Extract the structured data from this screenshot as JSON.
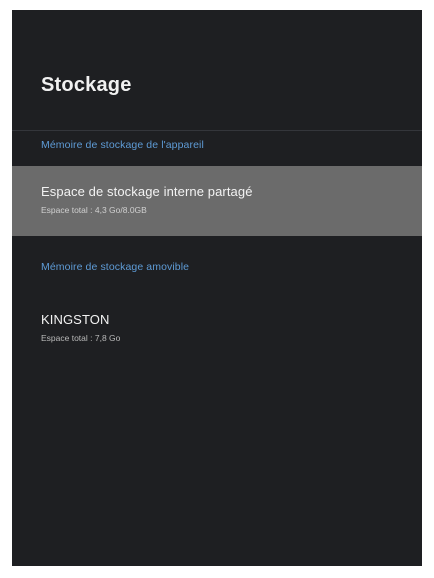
{
  "screen": {
    "title": "Stockage"
  },
  "sections": [
    {
      "header": "Mémoire de stockage de l'appareil",
      "items": [
        {
          "title": "Espace de stockage interne partagé",
          "subtitle": "Espace total : 4,3 Go/8.0GB",
          "selected": true
        }
      ]
    },
    {
      "header": "Mémoire de stockage amovible",
      "items": [
        {
          "title": "KINGSTON",
          "subtitle": "Espace total : 7,8 Go",
          "selected": false
        }
      ]
    }
  ],
  "colors": {
    "background": "#1e1f22",
    "section_header": "#5e9bd6",
    "selected_item": "#6b6b6b",
    "text_primary": "#f3f3f3"
  }
}
